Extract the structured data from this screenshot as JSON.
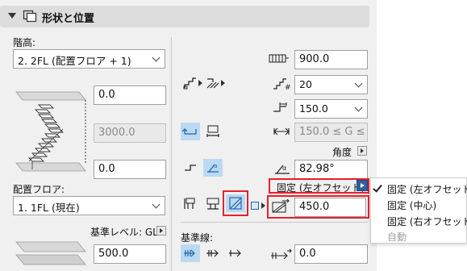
{
  "header": {
    "title": "形状と位置",
    "icon": "shape-position-icon"
  },
  "left": {
    "floor_label": "階高:",
    "floor_select": "2. 2FL (配置フロア + 1)",
    "top_offset": "0.0",
    "height_value": "3000.0",
    "bottom_offset": "0.0",
    "home_floor_label": "配置フロア:",
    "home_floor_select": "1. 1FL (現在)",
    "ref_level_label": "基準レベル: GL",
    "ref_level_value": "500.0"
  },
  "right": {
    "width_value": "900.0",
    "risers_value": "20",
    "going_value": "150.0",
    "going_range": "150.0 ≤ G ≤ 1",
    "angle_label": "角度",
    "angle_value": "82.98°",
    "anchor_label": "固定 (左オフセット)",
    "offset_value": "450.0",
    "baseline_label": "基準線:",
    "baseline_value": "0.0"
  },
  "menu": {
    "items": [
      "固定 (左オフセット)",
      "固定 (中心)",
      "固定 (右オフセット)",
      "自動"
    ],
    "checked": 0,
    "disabled": [
      3
    ]
  },
  "colors": {
    "highlight": "#e8202a",
    "selected_bg": "#bcd9f3"
  }
}
